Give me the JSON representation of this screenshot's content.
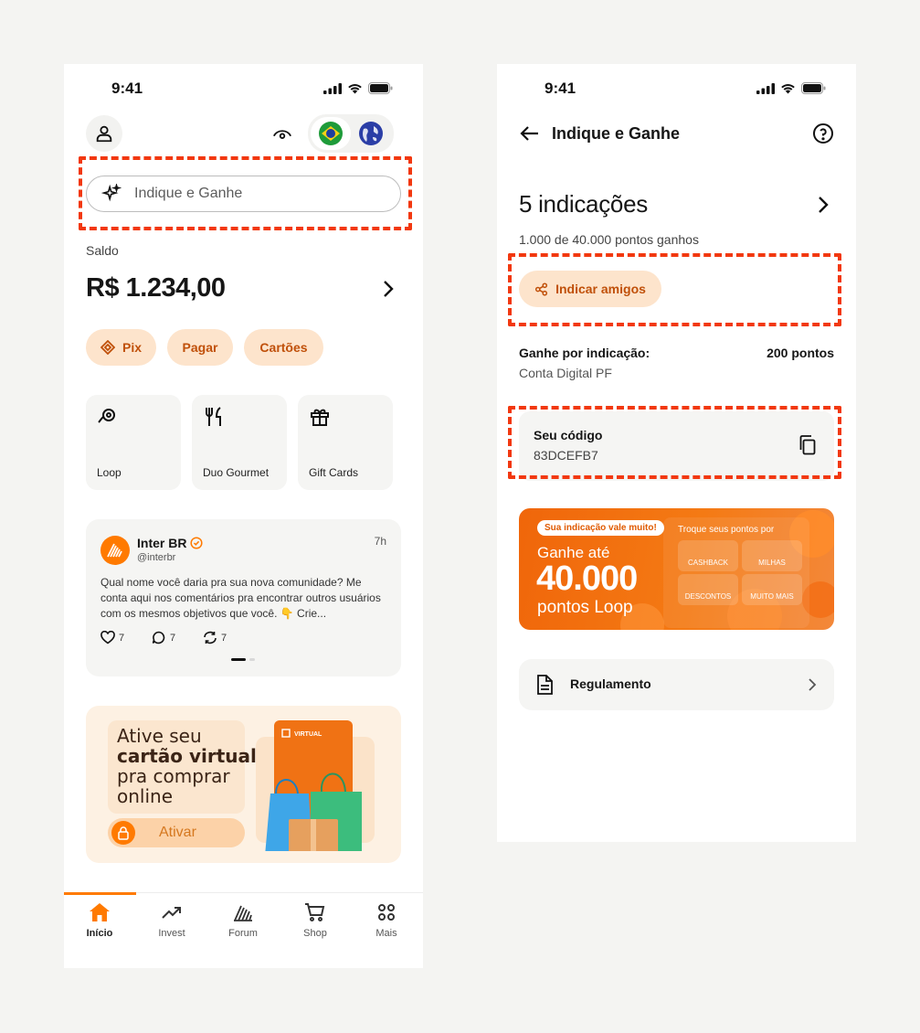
{
  "status": {
    "time": "9:41"
  },
  "home": {
    "search_placeholder": "Indique e Ganhe",
    "balance_label": "Saldo",
    "balance_value": "R$ 1.234,00",
    "actions": [
      {
        "label": "Pix"
      },
      {
        "label": "Pagar"
      },
      {
        "label": "Cartões"
      }
    ],
    "tiles": [
      {
        "label": "Loop",
        "icon": "loop-icon"
      },
      {
        "label": "Duo Gourmet",
        "icon": "utensils-icon"
      },
      {
        "label": "Gift Cards",
        "icon": "gift-icon"
      }
    ],
    "post": {
      "author": "Inter BR",
      "handle": "@interbr",
      "time": "7h",
      "text": "Qual nome você daria pra sua nova comunidade? Me conta aqui nos comentários pra encontrar outros usuários com os mesmos objetivos que você. 👇 Crie...",
      "likes": "7",
      "comments": "7",
      "reposts": "7"
    },
    "banner": {
      "line1": "Ative seu",
      "line2": "cartão virtual",
      "line3": "pra comprar",
      "line4": "online",
      "button": "Ativar",
      "card_label": "VIRTUAL"
    },
    "nav": [
      {
        "label": "Início",
        "icon": "home-icon"
      },
      {
        "label": "Invest",
        "icon": "trending-up-icon"
      },
      {
        "label": "Forum",
        "icon": "forum-icon"
      },
      {
        "label": "Shop",
        "icon": "cart-icon"
      },
      {
        "label": "Mais",
        "icon": "grid-icon"
      }
    ]
  },
  "refer": {
    "title": "Indique e Ganhe",
    "count": "5 indicações",
    "points_progress": "1.000 de 40.000 pontos ganhos",
    "invite_button": "Indicar amigos",
    "reward_label": "Ganhe por indicação:",
    "reward_value": "200 pontos",
    "account_type": "Conta Digital PF",
    "code_label": "Seu código",
    "code_value": "83DCEFB7",
    "promo": {
      "badge": "Sua indicação vale muito!",
      "line1": "Ganhe até",
      "amount": "40.000",
      "line2": "pontos Loop",
      "right_title": "Troque seus pontos por",
      "options": [
        "CASHBACK",
        "MILHAS",
        "DESCONTOS",
        "MUITO MAIS"
      ]
    },
    "rules": "Regulamento"
  },
  "colors": {
    "accent": "#ff7a00",
    "pill_bg": "#fde4cc",
    "highlight": "#f2380f"
  }
}
